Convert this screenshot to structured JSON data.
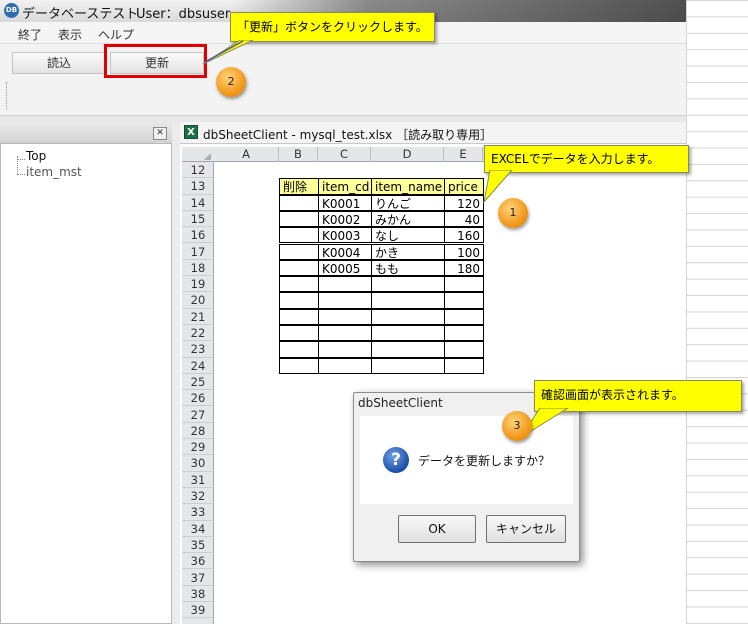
{
  "window": {
    "title": "データベーステスト",
    "user_label": "User：dbsuser"
  },
  "menu": [
    "終了",
    "表示",
    "ヘルプ"
  ],
  "toolbar": {
    "read_label": "読込",
    "update_label": "更新"
  },
  "tree": {
    "root": "Top",
    "child": "item_mst"
  },
  "spreadsheet": {
    "title": "dbSheetClient - mysql_test.xlsx ［読み取り専用］",
    "columns": [
      "A",
      "B",
      "C",
      "D",
      "E"
    ],
    "rows": [
      "12",
      "13",
      "14",
      "15",
      "16",
      "17",
      "18",
      "19",
      "20",
      "21",
      "22",
      "23",
      "24",
      "25",
      "26",
      "27",
      "28",
      "29",
      "30",
      "31",
      "32",
      "33",
      "34",
      "35",
      "36",
      "37",
      "38",
      "39"
    ],
    "headers": [
      "削除",
      "item_cd",
      "item_name",
      "price"
    ],
    "records": [
      [
        "",
        "K0001",
        "りんご",
        "120"
      ],
      [
        "",
        "K0002",
        "みかん",
        "40"
      ],
      [
        "",
        "K0003",
        "なし",
        "160"
      ],
      [
        "",
        "K0004",
        "かき",
        "100"
      ],
      [
        "",
        "K0005",
        "もも",
        "180"
      ]
    ]
  },
  "callouts": {
    "c1": "EXCELでデータを入力します。",
    "c2": "「更新」ボタンをクリックします。",
    "c3": "確認画面が表示されます。",
    "b1": "1",
    "b2": "2",
    "b3": "3"
  },
  "dialog": {
    "title": "dbSheetClient",
    "message": "データを更新しますか？",
    "ok_label": "OK",
    "cancel_label": "キャンセル"
  }
}
